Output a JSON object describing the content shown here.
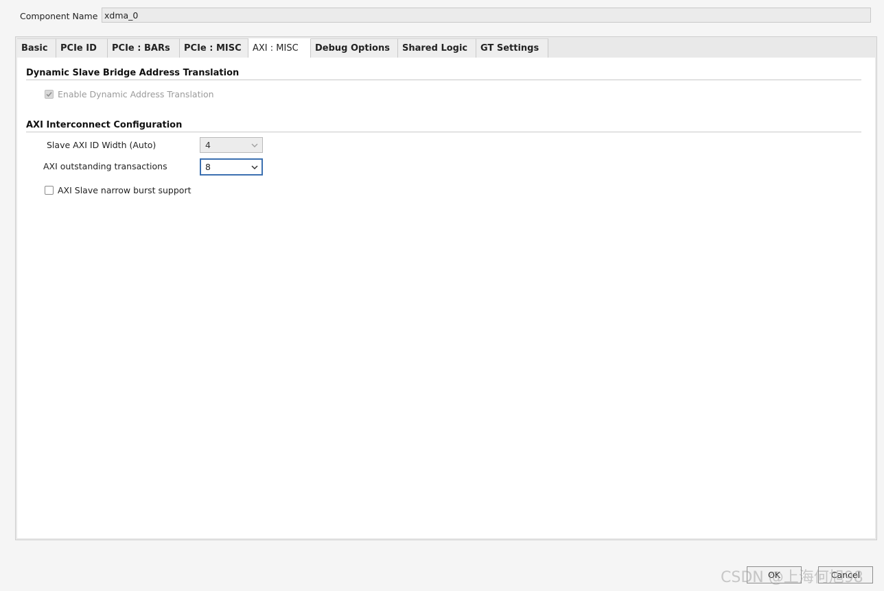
{
  "component": {
    "label": "Component Name",
    "value": "xdma_0"
  },
  "tabs": [
    {
      "label": "Basic"
    },
    {
      "label": "PCIe ID"
    },
    {
      "label": "PCIe : BARs"
    },
    {
      "label": "PCIe : MISC"
    },
    {
      "label": "AXI : MISC"
    },
    {
      "label": "Debug Options"
    },
    {
      "label": "Shared Logic"
    },
    {
      "label": "GT Settings"
    }
  ],
  "active_tab": "AXI : MISC",
  "dynamic_section": {
    "title": "Dynamic Slave Bridge Address Translation",
    "enable_label": "Enable Dynamic Address Translation",
    "enable_checked": true,
    "enable_disabled": true
  },
  "axi_section": {
    "title": "AXI Interconnect Configuration",
    "slave_id_width_label": "Slave AXI ID Width (Auto)",
    "slave_id_width_value": "4",
    "outstanding_label": "AXI outstanding transactions",
    "outstanding_value": "8",
    "narrow_burst_label": "AXI Slave narrow burst support",
    "narrow_burst_checked": false
  },
  "buttons": {
    "ok": "OK",
    "cancel": "Cancel"
  },
  "watermark": "CSDN @上海何旭98",
  "colors": {
    "focus_border": "#3a6fb0",
    "disabled_text": "#9a9a9a"
  }
}
